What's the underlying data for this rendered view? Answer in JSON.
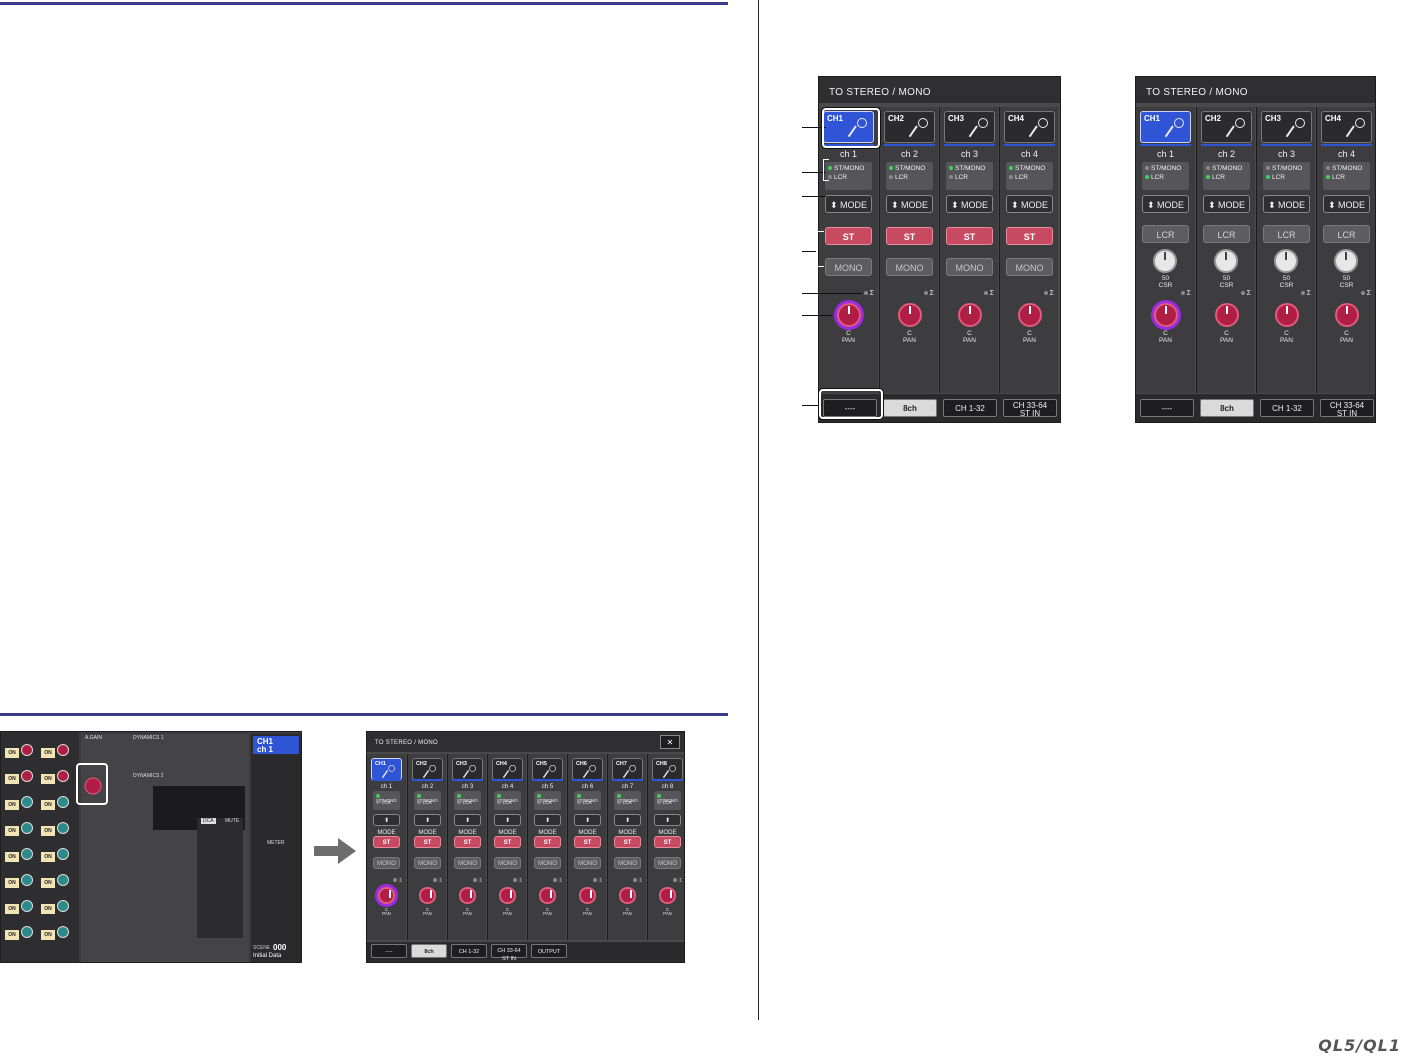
{
  "panel_a": {
    "title": "TO STEREO / MONO",
    "channels": [
      {
        "tag": "CH1",
        "name": "ch 1",
        "selected": true
      },
      {
        "tag": "CH2",
        "name": "ch 2",
        "selected": false
      },
      {
        "tag": "CH3",
        "name": "ch 3",
        "selected": false
      },
      {
        "tag": "CH4",
        "name": "ch 4",
        "selected": false
      }
    ],
    "status_labels": [
      "ST/MONO",
      "LCR"
    ],
    "mode_label": "⬍ MODE",
    "st_label": "ST",
    "mono_label": "MONO",
    "sigma": "Σ",
    "pan_value": "C",
    "pan_label": "PAN",
    "tabs": [
      {
        "label": "----",
        "on": false
      },
      {
        "label": "8ch",
        "on": true
      },
      {
        "label": "CH 1-32",
        "on": false
      },
      {
        "label": "CH 33-64",
        "label2": "ST IN",
        "on": false
      }
    ]
  },
  "panel_b": {
    "title": "TO STEREO / MONO",
    "channels": [
      {
        "tag": "CH1",
        "name": "ch 1",
        "selected": true
      },
      {
        "tag": "CH2",
        "name": "ch 2",
        "selected": false
      },
      {
        "tag": "CH3",
        "name": "ch 3",
        "selected": false
      },
      {
        "tag": "CH4",
        "name": "ch 4",
        "selected": false
      }
    ],
    "status_labels": [
      "ST/MONO",
      "LCR"
    ],
    "mode_label": "⬍ MODE",
    "lcr_label": "LCR",
    "csr_value": "50",
    "csr_label": "CSR",
    "sigma": "Σ",
    "pan_value": "C",
    "pan_label": "PAN",
    "tabs": [
      {
        "label": "----",
        "on": false
      },
      {
        "label": "8ch",
        "on": true
      },
      {
        "label": "CH 1-32",
        "on": false
      },
      {
        "label": "CH 33-64",
        "label2": "ST IN",
        "on": false
      }
    ]
  },
  "panel_c": {
    "title": "TO STEREO / MONO",
    "close": "✕",
    "channels": [
      {
        "tag": "CH1",
        "name": "ch 1",
        "selected": true
      },
      {
        "tag": "CH2",
        "name": "ch 2",
        "selected": false
      },
      {
        "tag": "CH3",
        "name": "ch 3",
        "selected": false
      },
      {
        "tag": "CH4",
        "name": "ch 4",
        "selected": false
      },
      {
        "tag": "CH5",
        "name": "ch 5",
        "selected": false
      },
      {
        "tag": "CH6",
        "name": "ch 6",
        "selected": false
      },
      {
        "tag": "CH7",
        "name": "ch 7",
        "selected": false
      },
      {
        "tag": "CH8",
        "name": "ch 8",
        "selected": false
      }
    ],
    "status_labels": [
      "ST/MONO",
      "LCR"
    ],
    "mode_label": "⬍ MODE",
    "st_label": "ST",
    "mono_label": "MONO",
    "sigma": "Σ",
    "pan_value": "C",
    "pan_label": "PAN",
    "tabs": [
      {
        "label": "----",
        "on": false
      },
      {
        "label": "8ch",
        "on": true
      },
      {
        "label": "CH 1-32",
        "on": false
      },
      {
        "label": "CH 33-64",
        "label2": "ST IN",
        "on": false
      },
      {
        "label": "OUTPUT",
        "on": false
      }
    ]
  },
  "mixer": {
    "header_tag": "CH1",
    "header_name": "ch 1",
    "scene_label": "SCENE",
    "scene_number": "000",
    "scene_name": "Initial Data",
    "on_label": "ON",
    "dca_label": "DCA",
    "mute_label": "MUTE",
    "dynamics1": "DYNAMICS 1",
    "dynamics2": "DYNAMICS 2",
    "again": "A.GAIN",
    "meter": "METER"
  },
  "logo": "QL5/QL1",
  "colors": {
    "rule": "#3b3b8e",
    "selected_channel": "#2f55d6",
    "st_button": "#c84a60",
    "pan_knob": "#b01e45",
    "pan_ring": "#9a2be0"
  }
}
